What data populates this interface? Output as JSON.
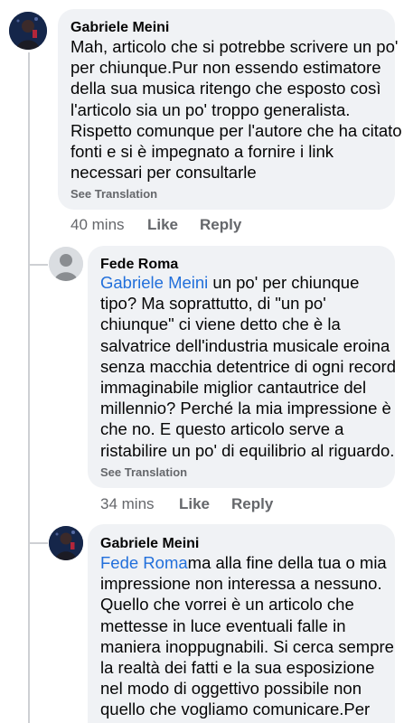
{
  "comments": [
    {
      "author": "Gabriele Meini",
      "lines": [
        "Mah, articolo che si potrebbe scrivere un po'",
        "per chiunque.Pur non essendo estimatore",
        "della sua musica ritengo che esposto così",
        "l'articolo sia un po' troppo generalista.",
        "Rispetto comunque per l'autore che ha citato",
        "fonti e si è impegnato a fornire i link",
        "necessari per consultarle"
      ],
      "see_translation": "See Translation",
      "time": "40 mins",
      "like": "Like",
      "reply": "Reply"
    },
    {
      "author": "Fede Roma",
      "mention": "Gabriele Meini",
      "first_line_rest": " un po' per chiunque",
      "lines": [
        "tipo? Ma soprattutto, di \"un po'",
        "chiunque\" ci viene detto che è la",
        "salvatrice dell'industria musicale eroina",
        "senza macchia detentrice di ogni record",
        "immaginabile miglior cantautrice del",
        "millennio? Perché la mia impressione è",
        "che no. E questo articolo serve a",
        "ristabilire un po' di equilibrio al riguardo."
      ],
      "see_translation": "See Translation",
      "time": "34 mins",
      "like": "Like",
      "reply": "Reply"
    },
    {
      "author": "Gabriele Meini",
      "mention": "Fede Roma",
      "first_line_rest": "ma alla fine della tua o mia",
      "lines": [
        "impressione non interessa a nessuno.",
        "Quello che vorrei è un articolo che",
        "mettesse in luce eventuali falle in",
        "maniera inoppugnabili. Si cerca sempre",
        "la realtà dei fatti e la sua esposizione",
        "nel modo di oggettivo possibile non",
        "quello che vogliamo comunicare.Per"
      ]
    }
  ],
  "colors": {
    "bubble": "#f0f2f5",
    "text": "#050505",
    "secondary": "#65676b",
    "mention": "#216fdb"
  },
  "icons": {
    "photo_avatar": "profile-photo-icon",
    "default_avatar": "default-user-icon"
  }
}
